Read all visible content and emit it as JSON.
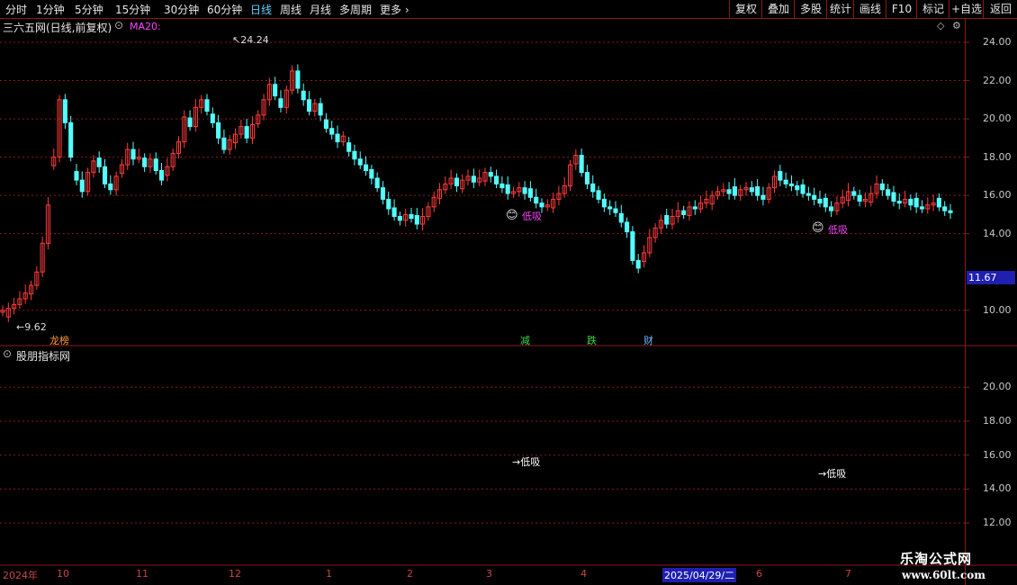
{
  "toolbar": {
    "periods": [
      "分时",
      "1分钟",
      "5分钟",
      "15分钟",
      "30分钟",
      "60分钟",
      "日线",
      "周线",
      "月线",
      "多周期",
      "更多"
    ],
    "active_period": "日线",
    "right_buttons": [
      "复权",
      "叠加",
      "多股",
      "统计",
      "画线",
      "F10",
      "标记",
      "+自选",
      "返回"
    ]
  },
  "main_panel": {
    "title": "三六五网(日线,前复权)",
    "indicator": "MA20:",
    "high_label": "24.24",
    "low_label": "9.62",
    "signal_label": "低吸",
    "current_price": "11.67",
    "events": [
      "龙榜",
      "减",
      "跌",
      "财"
    ]
  },
  "sub_panel": {
    "title": "股朋指标网",
    "signal_label": "→低吸"
  },
  "date_axis": {
    "year_label": "2024年",
    "months": [
      "10",
      "11",
      "12",
      "1",
      "2",
      "3",
      "4",
      "6",
      "7"
    ],
    "cursor_date": "2025/04/29/二"
  },
  "watermark": {
    "brand": "乐淘公式网",
    "url": "www.60lt.com"
  },
  "colors": {
    "up": "#ff3b3b",
    "down": "#54ffff",
    "grid": "#8b1a1a",
    "accent": "#ff40ff",
    "price_box": "#1f1fb0"
  },
  "chart_data": {
    "type": "candlestick",
    "main_y_ticks": [
      24,
      22,
      20,
      18,
      16,
      14,
      10
    ],
    "main_ylim": [
      9.0,
      24.8
    ],
    "sub_y_ticks": [
      20,
      18,
      16,
      14,
      12
    ],
    "sub_ylim": [
      11.0,
      21.5
    ],
    "high": 24.24,
    "low": 9.62,
    "last_price": 11.67,
    "closes": [
      10.0,
      10.1,
      10.3,
      10.6,
      10.9,
      11.3,
      12.0,
      13.5,
      15.5,
      18.0,
      21.0,
      19.8,
      18.0,
      16.8,
      16.2,
      17.2,
      17.8,
      17.5,
      16.6,
      16.3,
      17.0,
      17.6,
      18.4,
      17.9,
      18.0,
      17.5,
      17.9,
      17.3,
      16.8,
      17.5,
      18.2,
      18.8,
      20.1,
      19.6,
      20.6,
      21.0,
      20.4,
      19.8,
      19.0,
      18.4,
      18.9,
      19.2,
      19.6,
      19.0,
      19.7,
      20.2,
      21.0,
      21.8,
      21.2,
      20.6,
      21.5,
      22.5,
      21.6,
      21.0,
      20.4,
      20.8,
      20.2,
      19.5,
      19.2,
      18.8,
      19.1,
      18.3,
      17.9,
      17.6,
      17.3,
      16.9,
      16.4,
      15.8,
      15.3,
      14.9,
      14.7,
      15.0,
      14.8,
      14.5,
      14.9,
      15.4,
      15.9,
      16.3,
      16.6,
      16.9,
      16.5,
      16.8,
      17.0,
      16.7,
      16.9,
      17.2,
      17.0,
      16.6,
      16.4,
      16.1,
      16.2,
      16.4,
      16.1,
      15.9,
      15.6,
      15.4,
      15.5,
      15.8,
      16.1,
      16.5,
      17.6,
      18.1,
      17.2,
      16.6,
      16.2,
      15.8,
      15.4,
      15.3,
      15.1,
      14.6,
      14.1,
      12.6,
      12.2,
      13.0,
      13.8,
      14.3,
      14.7,
      14.5,
      14.9,
      15.2,
      15.0,
      15.4,
      15.3,
      15.6,
      15.8,
      16.0,
      16.2,
      16.3,
      16.1,
      16.0,
      16.3,
      16.4,
      16.2,
      16.0,
      15.8,
      16.4,
      17.0,
      16.8,
      16.6,
      16.5,
      16.3,
      16.1,
      16.0,
      15.8,
      15.6,
      15.4,
      15.2,
      15.6,
      15.9,
      16.2,
      16.0,
      15.7,
      15.8,
      16.1,
      16.6,
      16.3,
      16.0,
      15.7,
      15.6,
      15.8,
      15.5,
      15.4,
      15.3,
      15.5,
      15.6,
      15.4,
      15.2,
      15.1
    ]
  }
}
